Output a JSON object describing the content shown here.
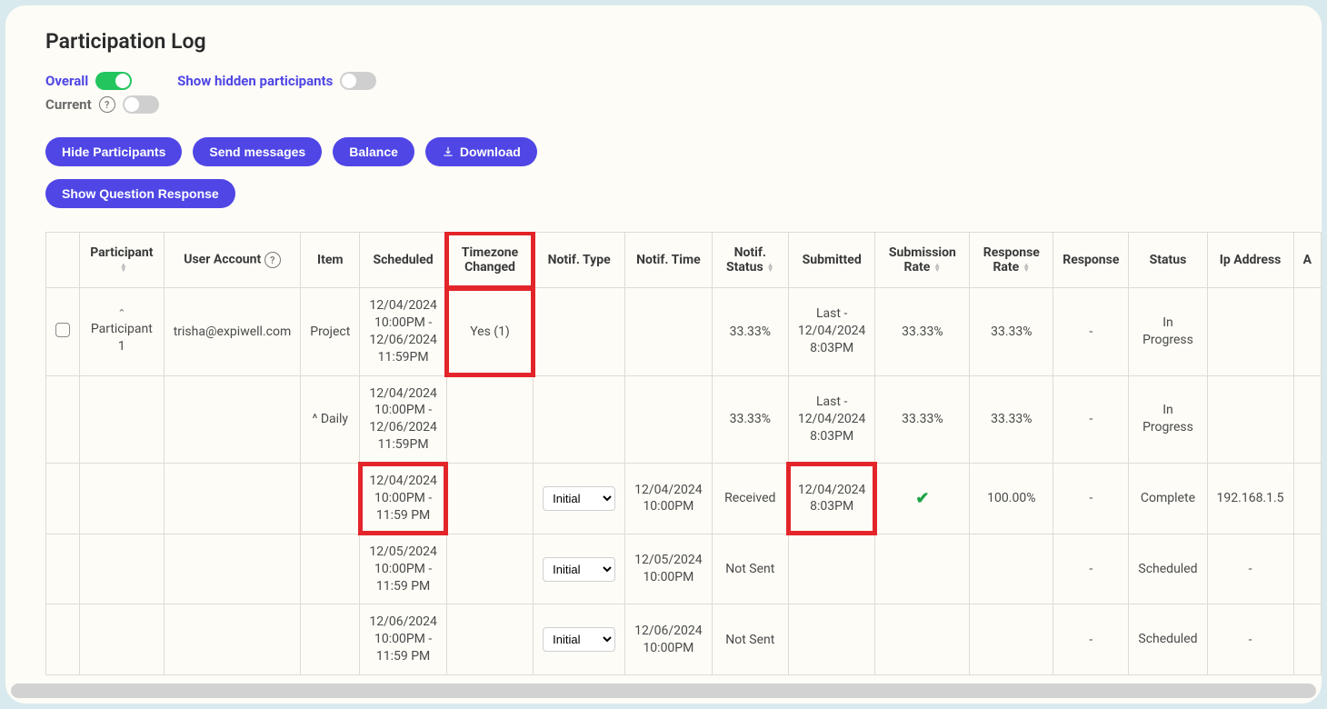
{
  "title": "Participation Log",
  "toggles": {
    "overall_label": "Overall",
    "show_hidden_label": "Show hidden participants",
    "current_label": "Current"
  },
  "buttons": {
    "hide_participants": "Hide Participants",
    "send_messages": "Send messages",
    "balance": "Balance",
    "download": "Download",
    "show_question_response": "Show Question Response"
  },
  "columns": {
    "checkbox": "",
    "participant": "Participant",
    "user_account": "User Account",
    "item": "Item",
    "scheduled": "Scheduled",
    "timezone_changed": "Timezone Changed",
    "notif_type": "Notif. Type",
    "notif_time": "Notif. Time",
    "notif_status": "Notif. Status",
    "submitted": "Submitted",
    "submission_rate": "Submission Rate",
    "response_rate": "Response Rate",
    "response": "Response",
    "status": "Status",
    "ip_address": "Ip Address",
    "a": "A"
  },
  "rows": [
    {
      "participant_caret": "⌃",
      "participant": "Participant 1",
      "user_account": "trisha@expiwell.com",
      "item": "Project",
      "scheduled": "12/04/2024 10:00PM - 12/06/2024 11:59PM",
      "timezone_changed": "Yes (1)",
      "notif_type": "",
      "notif_time": "",
      "notif_status": "33.33%",
      "submitted": "Last - 12/04/2024 8:03PM",
      "submission_rate": "33.33%",
      "response_rate": "33.33%",
      "response": "-",
      "status": "In Progress",
      "ip_address": "",
      "highlight_scheduled": false,
      "highlight_submitted": false,
      "highlight_tz": true,
      "has_select": false,
      "has_checkbox": true
    },
    {
      "participant": "",
      "user_account": "",
      "item": "^ Daily",
      "scheduled": "12/04/2024 10:00PM - 12/06/2024 11:59PM",
      "timezone_changed": "",
      "notif_type": "",
      "notif_time": "",
      "notif_status": "33.33%",
      "submitted": "Last - 12/04/2024 8:03PM",
      "submission_rate": "33.33%",
      "response_rate": "33.33%",
      "response": "-",
      "status": "In Progress",
      "ip_address": "",
      "highlight_scheduled": false,
      "highlight_submitted": false,
      "has_select": false,
      "has_checkbox": false
    },
    {
      "participant": "",
      "user_account": "",
      "item": "",
      "scheduled": "12/04/2024 10:00PM - 11:59 PM",
      "timezone_changed": "",
      "notif_type": "Initial",
      "notif_time": "12/04/2024 10:00PM",
      "notif_status": "Received",
      "submitted": "12/04/2024 8:03PM",
      "submission_rate": "check",
      "response_rate": "100.00%",
      "response": "-",
      "status": "Complete",
      "ip_address": "192.168.1.5",
      "highlight_scheduled": true,
      "highlight_submitted": true,
      "has_select": true,
      "has_checkbox": false
    },
    {
      "participant": "",
      "user_account": "",
      "item": "",
      "scheduled": "12/05/2024 10:00PM - 11:59 PM",
      "timezone_changed": "",
      "notif_type": "Initial",
      "notif_time": "12/05/2024 10:00PM",
      "notif_status": "Not Sent",
      "submitted": "",
      "submission_rate": "",
      "response_rate": "",
      "response": "-",
      "status": "Scheduled",
      "ip_address": "-",
      "highlight_scheduled": false,
      "highlight_submitted": false,
      "has_select": true,
      "has_checkbox": false
    },
    {
      "participant": "",
      "user_account": "",
      "item": "",
      "scheduled": "12/06/2024 10:00PM - 11:59 PM",
      "timezone_changed": "",
      "notif_type": "Initial",
      "notif_time": "12/06/2024 10:00PM",
      "notif_status": "Not Sent",
      "submitted": "",
      "submission_rate": "",
      "response_rate": "",
      "response": "-",
      "status": "Scheduled",
      "ip_address": "-",
      "highlight_scheduled": false,
      "highlight_submitted": false,
      "has_select": true,
      "has_checkbox": false
    }
  ]
}
